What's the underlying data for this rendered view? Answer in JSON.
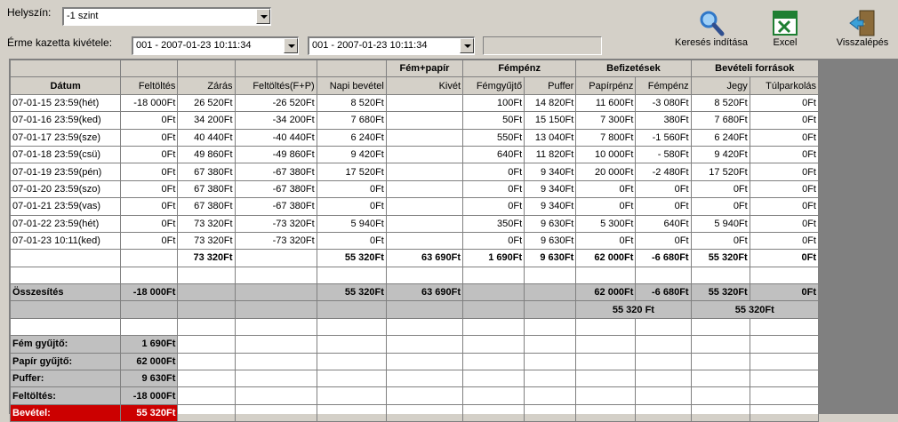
{
  "top": {
    "location_label": "Helyszín:",
    "location_value": "-1 szint",
    "cassette_label": "Érme kazetta kivétele:",
    "from_value": "001 - 2007-01-23 10:11:34",
    "to_value": "001 - 2007-01-23 10:11:34"
  },
  "toolbar": {
    "search_label": "Keresés indítása",
    "excel_label": "Excel",
    "back_label": "Visszalépés"
  },
  "colors": {
    "excel_green": "#1e7f32",
    "search_blue": "#2f77c8",
    "door_brown": "#8b6b3a",
    "total_red": "#cc0000"
  },
  "table": {
    "group_headers": [
      "Fém+papír",
      "Fémpénz",
      "Befizetések",
      "Bevételi források"
    ],
    "columns": [
      "Dátum",
      "Feltöltés",
      "Zárás",
      "Feltöltés(F+P)",
      "Napi bevétel",
      "Kivét",
      "Fémgyűjtő",
      "Puffer",
      "Papírpénz",
      "Fémpénz",
      "Jegy",
      "Túlparkolás"
    ],
    "rows": [
      [
        "07-01-15 23:59(hét)",
        "-18 000Ft",
        "26 520Ft",
        "-26 520Ft",
        "8 520Ft",
        "",
        "100Ft",
        "14 820Ft",
        "11 600Ft",
        "-3 080Ft",
        "8 520Ft",
        "0Ft"
      ],
      [
        "07-01-16 23:59(ked)",
        "0Ft",
        "34 200Ft",
        "-34 200Ft",
        "7 680Ft",
        "",
        "50Ft",
        "15 150Ft",
        "7 300Ft",
        "380Ft",
        "7 680Ft",
        "0Ft"
      ],
      [
        "07-01-17 23:59(sze)",
        "0Ft",
        "40 440Ft",
        "-40 440Ft",
        "6 240Ft",
        "",
        "550Ft",
        "13 040Ft",
        "7 800Ft",
        "-1 560Ft",
        "6 240Ft",
        "0Ft"
      ],
      [
        "07-01-18 23:59(csü)",
        "0Ft",
        "49 860Ft",
        "-49 860Ft",
        "9 420Ft",
        "",
        "640Ft",
        "11 820Ft",
        "10 000Ft",
        "- 580Ft",
        "9 420Ft",
        "0Ft"
      ],
      [
        "07-01-19 23:59(pén)",
        "0Ft",
        "67 380Ft",
        "-67 380Ft",
        "17 520Ft",
        "",
        "0Ft",
        "9 340Ft",
        "20 000Ft",
        "-2 480Ft",
        "17 520Ft",
        "0Ft"
      ],
      [
        "07-01-20 23:59(szo)",
        "0Ft",
        "67 380Ft",
        "-67 380Ft",
        "0Ft",
        "",
        "0Ft",
        "9 340Ft",
        "0Ft",
        "0Ft",
        "0Ft",
        "0Ft"
      ],
      [
        "07-01-21 23:59(vas)",
        "0Ft",
        "67 380Ft",
        "-67 380Ft",
        "0Ft",
        "",
        "0Ft",
        "9 340Ft",
        "0Ft",
        "0Ft",
        "0Ft",
        "0Ft"
      ],
      [
        "07-01-22 23:59(hét)",
        "0Ft",
        "73 320Ft",
        "-73 320Ft",
        "5 940Ft",
        "",
        "350Ft",
        "9 630Ft",
        "5 300Ft",
        "640Ft",
        "5 940Ft",
        "0Ft"
      ],
      [
        "07-01-23 10:11(ked)",
        "0Ft",
        "73 320Ft",
        "-73 320Ft",
        "0Ft",
        "",
        "0Ft",
        "9 630Ft",
        "0Ft",
        "0Ft",
        "0Ft",
        "0Ft"
      ]
    ],
    "subtotal_row": [
      "",
      "",
      "73 320Ft",
      "",
      "55 320Ft",
      "63 690Ft",
      "1 690Ft",
      "9 630Ft",
      "62 000Ft",
      "-6 680Ft",
      "55 320Ft",
      "0Ft"
    ],
    "summary_label": "Összesítés",
    "summary_row": [
      "-18 000Ft",
      "",
      "",
      "55 320Ft",
      "63 690Ft",
      "",
      "",
      "62 000Ft",
      "-6 680Ft",
      "55 320Ft",
      "0Ft"
    ],
    "combined_befizetesek": "55 320 Ft",
    "combined_bevetel": "55 320Ft",
    "totals": [
      {
        "label": "Fém gyűjtő:",
        "value": "1 690Ft"
      },
      {
        "label": "Papír gyűjtő:",
        "value": "62 000Ft"
      },
      {
        "label": "Puffer:",
        "value": "9 630Ft"
      },
      {
        "label": "Feltöltés:",
        "value": "-18 000Ft"
      },
      {
        "label": "Bevétel:",
        "value": "55 320Ft"
      }
    ]
  }
}
